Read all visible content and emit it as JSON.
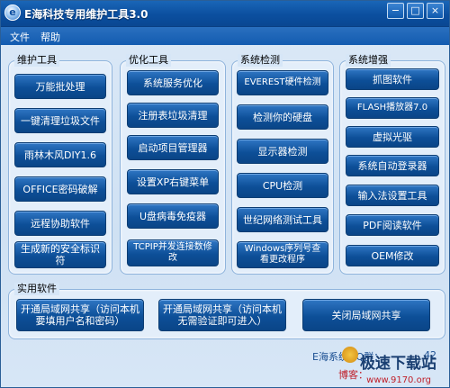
{
  "window": {
    "title": "E海科技专用维护工具3.0",
    "icon_letter": "e",
    "controls": {
      "minimize": "−",
      "maximize": "□",
      "close": "×"
    }
  },
  "menu": [
    "文件",
    "帮助"
  ],
  "groups": [
    {
      "title": "维护工具",
      "buttons": [
        "万能批处理",
        "一键清理垃圾文件",
        "雨林木风DIY1.6",
        "OFFICE密码破解",
        "远程协助软件",
        "生成新的安全标识符"
      ]
    },
    {
      "title": "优化工具",
      "buttons": [
        "系统服务优化",
        "注册表垃圾清理",
        "启动项目管理器",
        "设置XP右键菜单",
        "U盘病毒免疫器",
        "TCPIP并发连接数修改"
      ]
    },
    {
      "title": "系统检测",
      "buttons": [
        "EVEREST硬件检测",
        "检测你的硬盘",
        "显示器检测",
        "CPU检测",
        "世纪网络测试工具",
        "Windows序列号查看更改程序"
      ]
    },
    {
      "title": "系统增强",
      "buttons": [
        "抓图软件",
        "FLASH播放器7.0",
        "虚拟光驱",
        "系统自动登录器",
        "输入法设置工具",
        "PDF阅读软件",
        "OEM修改"
      ]
    }
  ],
  "practical": {
    "title": "实用软件",
    "buttons": [
      "开通局域网共享（访问本机要填用户名和密码）",
      "开通局域网共享（访问本机无需验证即可进入）",
      "关闭局域网共享"
    ]
  },
  "footer": {
    "line1": "E海系统QQ群：",
    "line1_tail": "42",
    "line2": "博客：",
    "watermark": "极速下载站",
    "watermark_url": "www.9170.org"
  }
}
